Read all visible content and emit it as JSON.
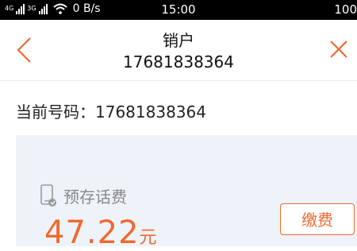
{
  "status_bar": {
    "signal_1": "4G",
    "signal_2": "3G",
    "net_speed": "0 B/s",
    "time": "15:00",
    "battery": "100"
  },
  "header": {
    "title": "销户",
    "subtitle": "17681838364",
    "back_icon": "chevron-left-icon",
    "close_icon": "close-icon"
  },
  "current_number": {
    "text": "当前号码：17681838364"
  },
  "balance_card": {
    "icon": "phone-icon",
    "label": "预存话费",
    "amount": "47.22",
    "amount_unit": "元",
    "pay_label": "缴费"
  },
  "colors": {
    "accent": "#ee6a2f",
    "card_bg": "#eef3f9"
  }
}
